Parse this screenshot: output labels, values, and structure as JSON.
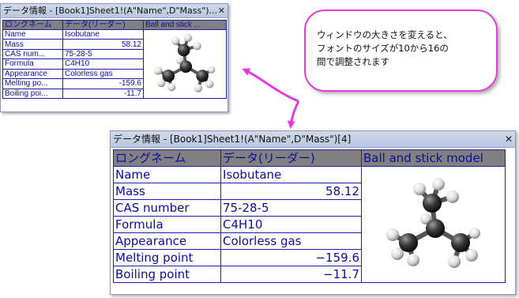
{
  "small_window": {
    "title": "データ情報 - [Book1]Sheet1!(A\"Name\",D\"Mass\")...",
    "close": "✕",
    "headers": [
      "ロングネーム",
      "データ(リーダー)",
      "Ball and stick ..."
    ],
    "rows": [
      {
        "label": "Name",
        "value": "Isobutane"
      },
      {
        "label": "Mass",
        "value": "58.12"
      },
      {
        "label": "CAS num...",
        "value": "75-28-5"
      },
      {
        "label": "Formula",
        "value": "C4H10"
      },
      {
        "label": "Appearance",
        "value": "Colorless gas"
      },
      {
        "label": "Melting po...",
        "value": "-159.6"
      },
      {
        "label": "Boiling poi...",
        "value": "-11.7"
      }
    ]
  },
  "large_window": {
    "title": "データ情報 - [Book1]Sheet1!(A\"Name\",D\"Mass\")[4]",
    "close": "✕",
    "headers": [
      "ロングネーム",
      "データ(リーダー)",
      "Ball and stick model"
    ],
    "rows": [
      {
        "label": "Name",
        "value": "Isobutane"
      },
      {
        "label": "Mass",
        "value": "58.12"
      },
      {
        "label": "CAS number",
        "value": "75-28-5"
      },
      {
        "label": "Formula",
        "value": "C4H10"
      },
      {
        "label": "Appearance",
        "value": "Colorless gas"
      },
      {
        "label": "Melting point",
        "value": "−159.6"
      },
      {
        "label": "Boiling point",
        "value": "−11.7"
      }
    ]
  },
  "callout": {
    "lines": [
      "ウィンドウの大きさを変えると、",
      "フォントのサイズが10から16の",
      "間で調整されます"
    ]
  },
  "colors": {
    "text": "#0d0d9a",
    "grid": "#1e1ea8",
    "header_bg": "#808080",
    "callout_border": "#e23ce0",
    "arrow": "#e23ce0"
  },
  "icons": {
    "close": "close-icon",
    "molecule": "ball-and-stick-molecule-image"
  }
}
